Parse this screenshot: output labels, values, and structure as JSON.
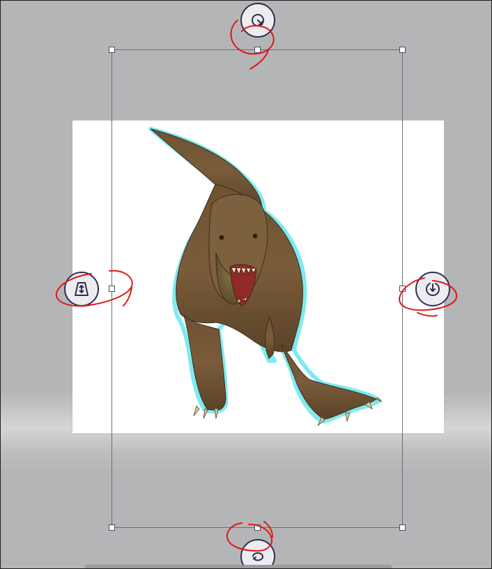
{
  "canvas": {
    "background_color": "#b4b5b6",
    "image_background_color": "#ffffff",
    "selection_outline_color": "#6ee9ef",
    "annotation_color": "#e01818"
  },
  "image": {
    "subject_icon": "t-rex-dinosaur"
  },
  "controls": {
    "top": {
      "icon": "rotate-icon"
    },
    "left": {
      "icon": "perspective-icon"
    },
    "right": {
      "icon": "tilt-icon"
    },
    "bottom": {
      "icon": "flip-icon"
    }
  }
}
